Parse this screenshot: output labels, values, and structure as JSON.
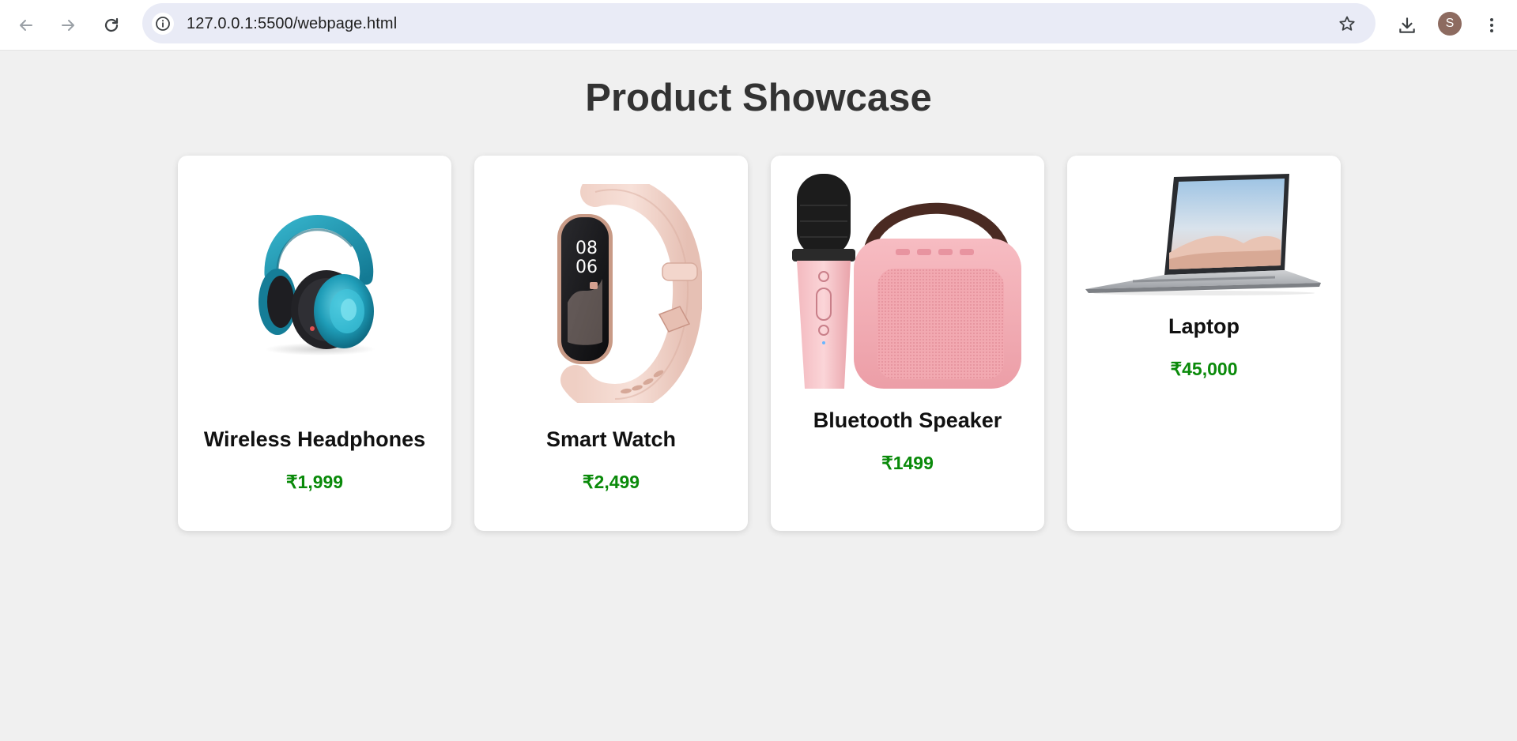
{
  "browser": {
    "url": "127.0.0.1:5500/webpage.html",
    "profile_initial": "S",
    "icons": {
      "back": "arrow-left-icon",
      "forward": "arrow-right-icon",
      "reload": "reload-icon",
      "site_info": "info-icon",
      "bookmark": "star-icon",
      "downloads": "download-icon",
      "menu": "vertical-dots-icon"
    }
  },
  "page": {
    "title": "Product Showcase"
  },
  "products": [
    {
      "name": "Wireless Headphones",
      "price": "₹1,999",
      "image": "headphones-image"
    },
    {
      "name": "Smart Watch",
      "price": "₹2,499",
      "image": "smart-watch-image"
    },
    {
      "name": "Bluetooth Speaker",
      "price": "₹1499",
      "image": "bluetooth-speaker-image"
    },
    {
      "name": "Laptop",
      "price": "₹45,000",
      "image": "laptop-image"
    }
  ],
  "colors": {
    "page_background": "#f0f0f0",
    "card_background": "#ffffff",
    "title_text": "#333333",
    "price_text": "#0a8a0a",
    "omnibox_background": "#e9ebf6",
    "avatar_background": "#8d6b60"
  }
}
